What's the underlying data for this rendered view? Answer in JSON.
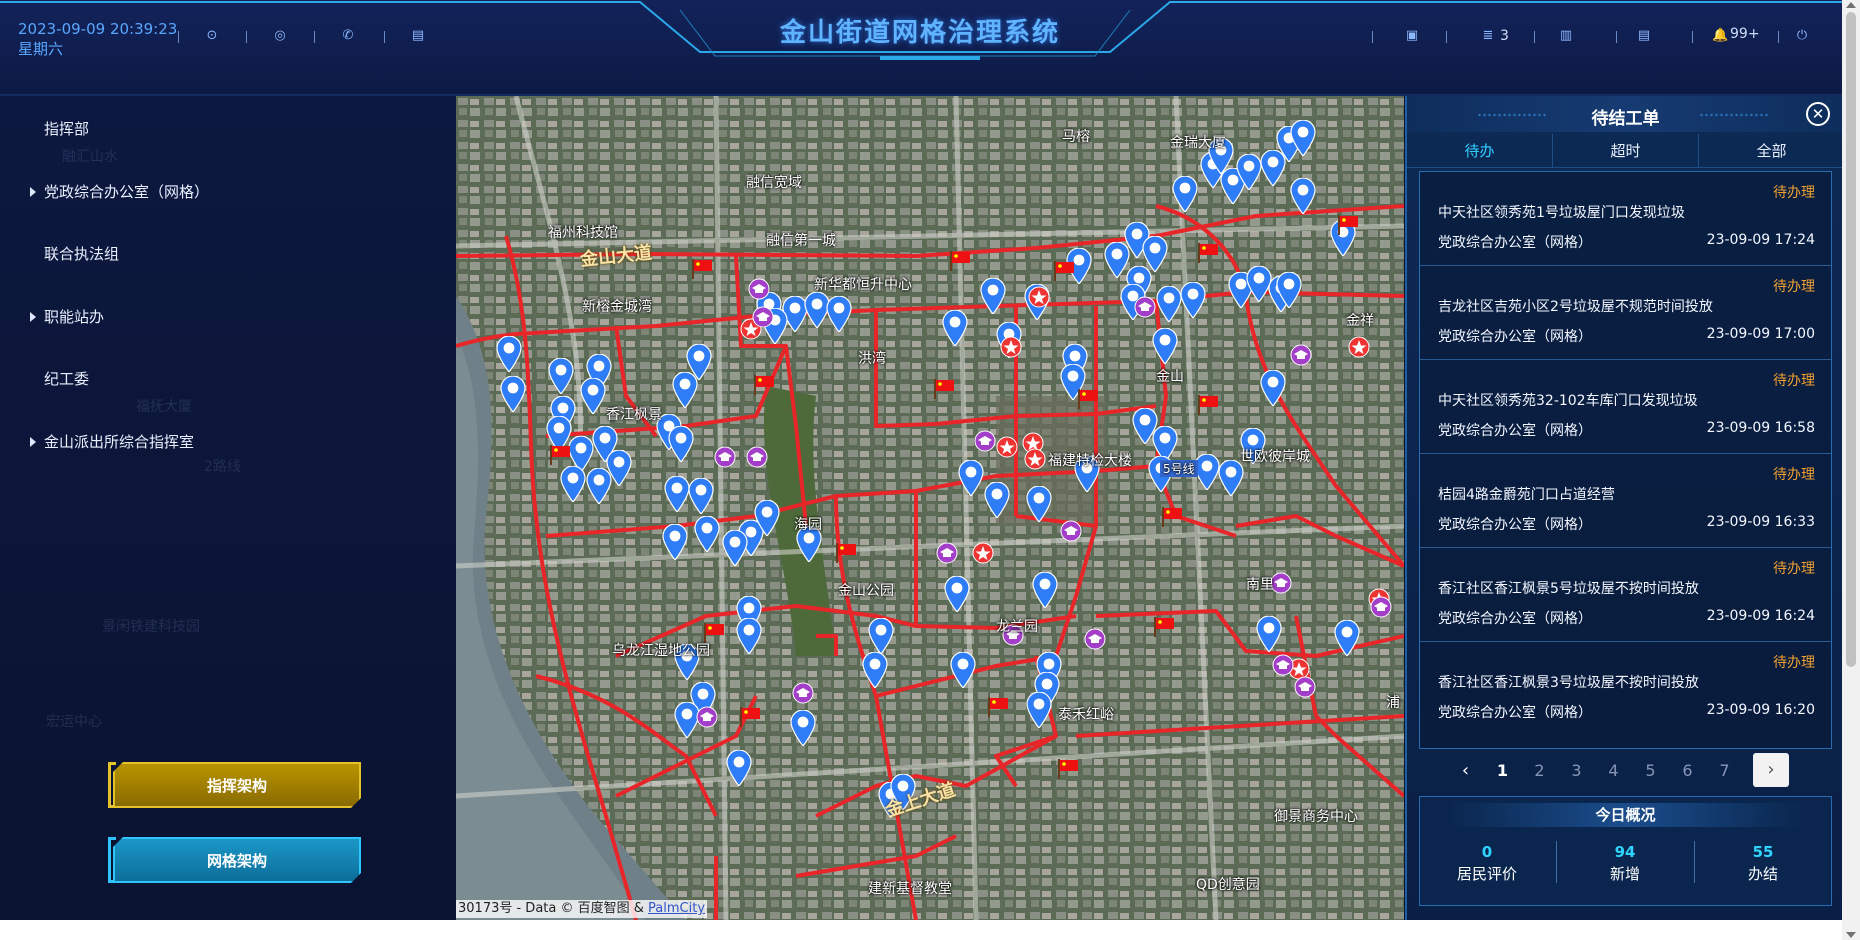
{
  "header": {
    "datetime": "2023-09-09 20:39:23",
    "weekday": "星期六",
    "title": "金山街道网格治理系统",
    "left_icons": [
      "compass-icon",
      "target-icon",
      "phone-icon",
      "book-icon"
    ],
    "right_icons": [
      "image-icon",
      "list-icon",
      "document-icon",
      "book-icon",
      "bell-icon",
      "power-icon"
    ],
    "list_count": "3",
    "bell_count": "99+"
  },
  "left_panel": {
    "tree": [
      {
        "label": "指挥部",
        "expandable": false
      },
      {
        "label": "党政综合办公室（网格）",
        "expandable": true
      },
      {
        "label": "联合执法组",
        "expandable": false
      },
      {
        "label": "职能站办",
        "expandable": true
      },
      {
        "label": "纪工委",
        "expandable": false
      },
      {
        "label": "金山派出所综合指挥室",
        "expandable": true
      }
    ],
    "buttons": {
      "command_arch": "指挥架构",
      "grid_arch": "网格架构"
    }
  },
  "map": {
    "labels": {
      "mage": "马榕",
      "jinrui": "金瑞大厦",
      "rongxin_kuancheng": "融信宽域",
      "rongxin_diyicheng": "融信第一城",
      "fuzhou_kejiguan": "福州科技馆",
      "xinhua_du": "新华都恒升中心",
      "xinrong_jincheng": "新榕金城湾",
      "hongwan": "洪湾",
      "jinshan": "金山",
      "jinxiang": "金祥",
      "xiangjiang_fengjing": "香江枫景",
      "fujian_tejian": "福建特检大楼",
      "shiou": "世欧彼岸城",
      "jinshan_park": "金山公园",
      "wulongjiang": "乌龙江湿地公园",
      "taihe": "泰禾红峪",
      "yujing": "御景商务中心",
      "jianxin": "建新基督教堂",
      "qd": "QD创意园",
      "haiyuan": "海园",
      "line5": "5号线",
      "jiangli": "南里",
      "lanyuan": "龙兰园",
      "pu": "浦"
    },
    "road_labels": {
      "jinshan_dadao": "金山大道",
      "jinshang_dadao": "金上大道"
    },
    "attribution": "30173号 - Data © 百度智图 & ",
    "attribution_link": "PalmCity"
  },
  "right_panel": {
    "title": "待结工单",
    "tabs": [
      "待办",
      "超时",
      "全部"
    ],
    "active_tab": "待办",
    "items": [
      {
        "status": "待办理",
        "title": "中天社区领秀苑1号垃圾屋门口发现垃圾",
        "dept": "党政综合办公室（网格）",
        "time": "23-09-09 17:24"
      },
      {
        "status": "待办理",
        "title": "吉龙社区吉苑小区2号垃圾屋不规范时间投放",
        "dept": "党政综合办公室（网格）",
        "time": "23-09-09 17:00"
      },
      {
        "status": "待办理",
        "title": "中天社区领秀苑32-102车库门口发现垃圾",
        "dept": "党政综合办公室（网格）",
        "time": "23-09-09 16:58"
      },
      {
        "status": "待办理",
        "title": "桔园4路金爵苑门口占道经营",
        "dept": "党政综合办公室（网格）",
        "time": "23-09-09 16:33"
      },
      {
        "status": "待办理",
        "title": "香江社区香江枫景5号垃圾屋不按时间投放",
        "dept": "党政综合办公室（网格）",
        "time": "23-09-09 16:24"
      },
      {
        "status": "待办理",
        "title": "香江社区香江枫景3号垃圾屋不按时间投放",
        "dept": "党政综合办公室（网格）",
        "time": "23-09-09 16:20"
      }
    ],
    "pager": {
      "pages": [
        "1",
        "2",
        "3",
        "4",
        "5",
        "6",
        "7"
      ],
      "current": "1",
      "prev": "‹",
      "next": "›"
    },
    "summary": {
      "title": "今日概况",
      "stats": [
        {
          "value": "0",
          "label": "居民评价"
        },
        {
          "value": "94",
          "label": "新增"
        },
        {
          "value": "55",
          "label": "办结"
        }
      ]
    }
  },
  "colors": {
    "accent": "#30d4ff",
    "pending": "#f0a030",
    "grid_line": "#e02020",
    "gold_button": "#b89400",
    "blue_button": "#1a97c7"
  }
}
